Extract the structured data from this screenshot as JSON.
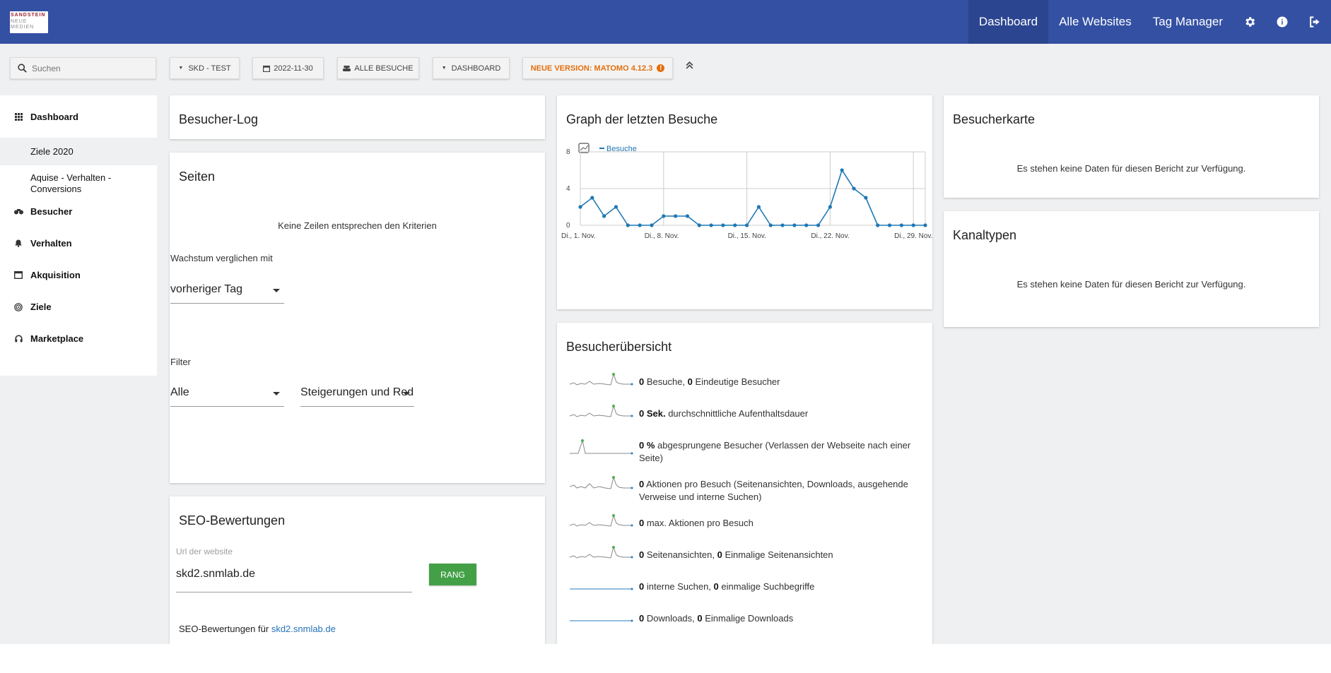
{
  "logo": {
    "line1": "SANDSTEIN",
    "line2": "NEUE",
    "line3": "MEDIEN"
  },
  "topnav": {
    "dashboard": "Dashboard",
    "all_websites": "Alle Websites",
    "tag_manager": "Tag Manager"
  },
  "toolbar": {
    "search_placeholder": "Suchen",
    "site": "SKD - TEST",
    "date": "2022-11-30",
    "segment": "ALLE BESUCHE",
    "dashboard": "DASHBOARD",
    "notice": "NEUE VERSION: MATOMO 4.12.3"
  },
  "menu": {
    "dashboard": "Dashboard",
    "sub1": "Ziele 2020",
    "sub2": "Aquise - Verhalten - Conversions",
    "visitors": "Besucher",
    "behaviour": "Verhalten",
    "acquisition": "Akquisition",
    "goals": "Ziele",
    "marketplace": "Marketplace"
  },
  "visitor_log": {
    "title": "Besucher-Log"
  },
  "pages": {
    "title": "Seiten",
    "empty": "Keine Zeilen entsprechen den Kriterien",
    "compare_label": "Wachstum verglichen mit",
    "compare_value": "vorheriger Tag",
    "filter_label": "Filter",
    "filter_value": "Alle",
    "filter_value2": "Steigerungen und Reduzierungen"
  },
  "seo": {
    "title": "SEO-Bewertungen",
    "url_label": "Url der website",
    "url_value": "skd2.snmlab.de",
    "button": "RANG",
    "result_prefix": "SEO-Bewertungen für",
    "result_link": "skd2.snmlab.de"
  },
  "graph": {
    "title": "Graph der letzten Besuche",
    "legend": "Besuche"
  },
  "chart_data": {
    "type": "line",
    "title": "",
    "xlabel": "",
    "ylabel": "",
    "x": [
      "2022-11-01",
      "2022-11-02",
      "2022-11-03",
      "2022-11-04",
      "2022-11-05",
      "2022-11-06",
      "2022-11-07",
      "2022-11-08",
      "2022-11-09",
      "2022-11-10",
      "2022-11-11",
      "2022-11-12",
      "2022-11-13",
      "2022-11-14",
      "2022-11-15",
      "2022-11-16",
      "2022-11-17",
      "2022-11-18",
      "2022-11-19",
      "2022-11-20",
      "2022-11-21",
      "2022-11-22",
      "2022-11-23",
      "2022-11-24",
      "2022-11-25",
      "2022-11-26",
      "2022-11-27",
      "2022-11-28",
      "2022-11-29",
      "2022-11-30"
    ],
    "x_tick_labels": [
      "Di., 1. Nov.",
      "Di., 8. Nov.",
      "Di., 15. Nov.",
      "Di., 22. Nov.",
      "Di., 29. Nov."
    ],
    "y_ticks": [
      "0",
      "4",
      "8"
    ],
    "ylim": [
      0,
      8
    ],
    "series": [
      {
        "name": "Besuche",
        "color": "#1f78b4",
        "values": [
          2,
          3,
          1,
          2,
          0,
          0,
          0,
          1,
          1,
          1,
          0,
          0,
          0,
          0,
          0,
          2,
          0,
          0,
          0,
          0,
          0,
          2,
          6,
          4,
          3,
          0,
          0,
          0,
          0,
          0
        ]
      }
    ],
    "grid": true,
    "legend": "top-left"
  },
  "overview": {
    "title": "Besucherübersicht",
    "rows": [
      {
        "v1": "0",
        "t1": " Besuche, ",
        "v2": "0",
        "t2": " Eindeutige Besucher"
      },
      {
        "v1": "0 Sek.",
        "t1": " durchschnittliche Aufenthaltsdauer",
        "v2": "",
        "t2": ""
      },
      {
        "v1": "0 %",
        "t1": " abgesprungene Besucher (Verlassen der Webseite nach einer Seite)",
        "v2": "",
        "t2": ""
      },
      {
        "v1": "0",
        "t1": " Aktionen pro Besuch (Seitenansichten, Downloads, ausgehende Verweise und interne Suchen)",
        "v2": "",
        "t2": ""
      },
      {
        "v1": "0",
        "t1": " max. Aktionen pro Besuch",
        "v2": "",
        "t2": ""
      },
      {
        "v1": "0",
        "t1": " Seitenansichten, ",
        "v2": "0",
        "t2": " Einmalige Seitenansichten"
      },
      {
        "v1": "0",
        "t1": " interne Suchen, ",
        "v2": "0",
        "t2": " einmalige Suchbegriffe"
      },
      {
        "v1": "0",
        "t1": " Downloads, ",
        "v2": "0",
        "t2": " Einmalige Downloads"
      }
    ]
  },
  "map": {
    "title": "Besucherkarte",
    "empty": "Es stehen keine Daten für diesen Bericht zur Verfügung."
  },
  "channels": {
    "title": "Kanaltypen",
    "empty": "Es stehen keine Daten für diesen Bericht zur Verfügung."
  }
}
